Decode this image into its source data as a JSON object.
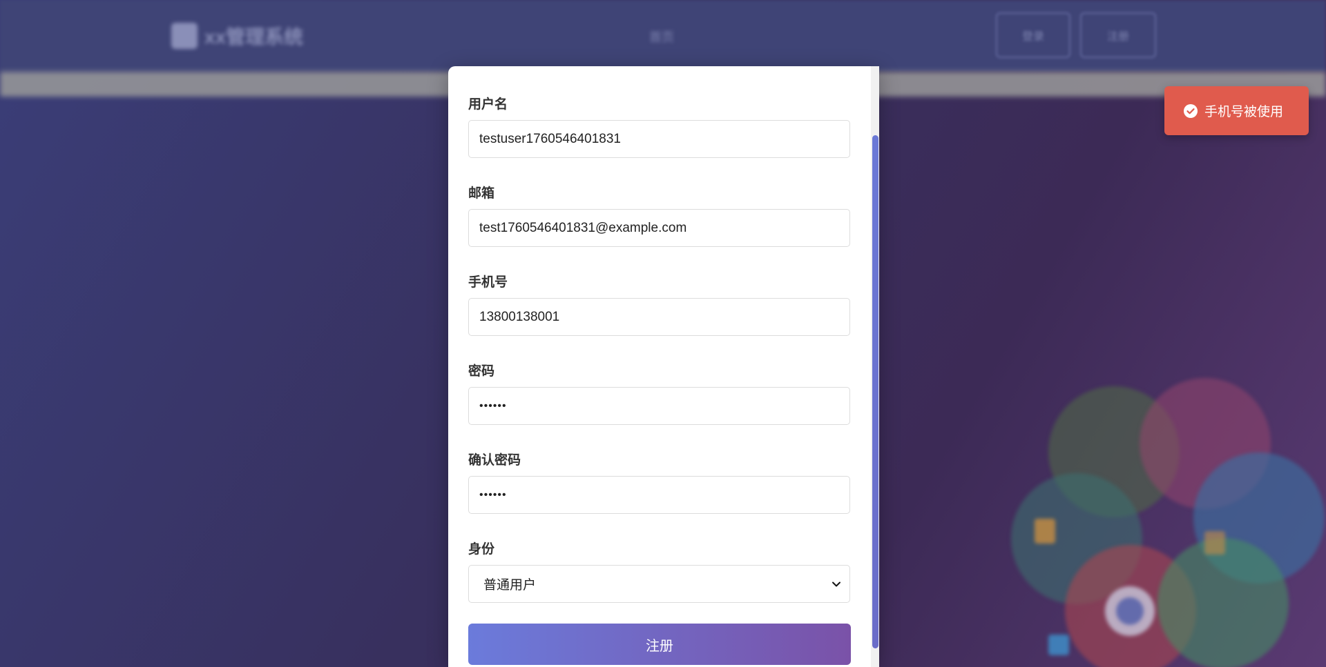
{
  "background": {
    "app_title": "xx管理系统",
    "nav_label": "首页",
    "login_button": "登录",
    "register_button": "注册"
  },
  "form": {
    "username": {
      "label": "用户名",
      "value": "testuser1760546401831"
    },
    "email": {
      "label": "邮箱",
      "value": "test1760546401831@example.com"
    },
    "phone": {
      "label": "手机号",
      "value": "13800138001"
    },
    "password": {
      "label": "密码",
      "value": "••••••"
    },
    "confirm_password": {
      "label": "确认密码",
      "value": "••••••"
    },
    "role": {
      "label": "身份",
      "selected": "普通用户"
    },
    "submit_label": "注册"
  },
  "toast": {
    "message": "手机号被使用",
    "icon": "check-circle-icon",
    "color": "#e05b4d"
  },
  "colors": {
    "accent_start": "#6b7bdb",
    "accent_end": "#7a52a8"
  }
}
